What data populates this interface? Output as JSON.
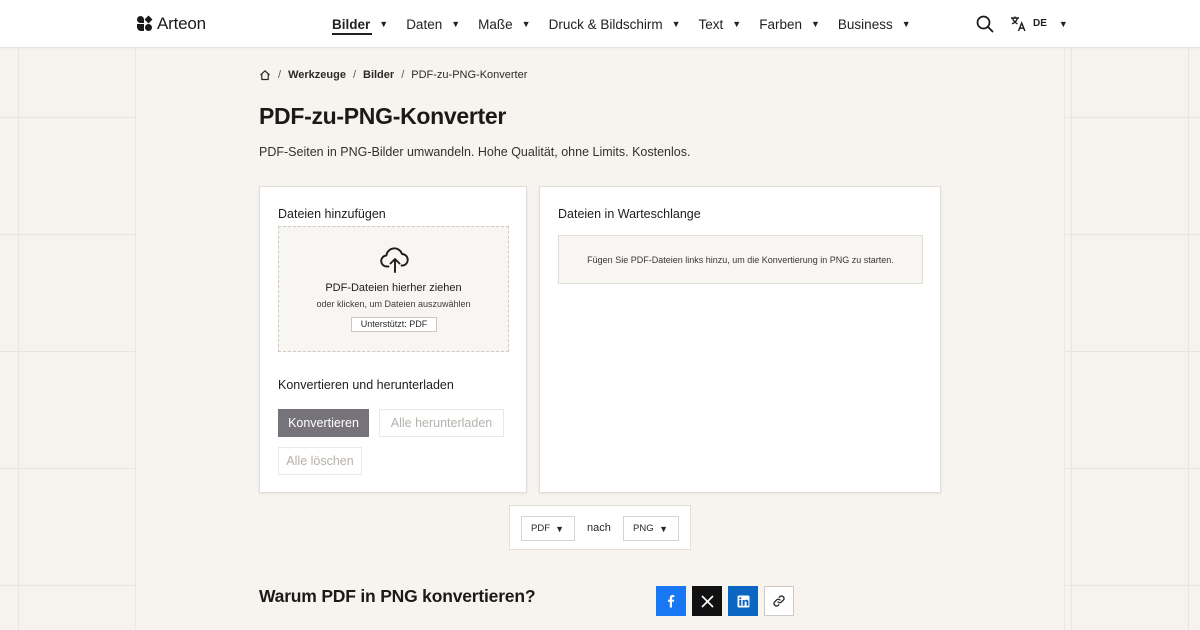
{
  "header": {
    "brand": "Arteon",
    "nav": [
      {
        "label": "Bilder",
        "active": true
      },
      {
        "label": "Daten"
      },
      {
        "label": "Maße"
      },
      {
        "label": "Druck & Bildschirm"
      },
      {
        "label": "Text"
      },
      {
        "label": "Farben"
      },
      {
        "label": "Business"
      }
    ],
    "caret": "▼",
    "search_icon": "search-icon",
    "language": "DE",
    "language_icon": "translate-icon"
  },
  "breadcrumb": {
    "home_icon": "home-icon",
    "separator": "/",
    "items": [
      "Werkzeuge",
      "Bilder",
      "PDF-zu-PNG-Konverter"
    ]
  },
  "page": {
    "title": "PDF-zu-PNG-Konverter",
    "subtitle": "PDF-Seiten in PNG-Bilder umwandeln. Hohe Qualität, ohne Limits. Kostenlos."
  },
  "add_card": {
    "heading": "Dateien hinzufügen",
    "dropzone": {
      "icon": "cloud-upload-icon",
      "title": "PDF-Dateien hierher ziehen",
      "subtitle": "oder klicken, um Dateien auszuwählen",
      "badge": "Unterstützt: PDF"
    },
    "convert_heading": "Konvertieren und herunterladen",
    "convert_button": "Konvertieren",
    "download_all_button": "Alle herunterladen",
    "clear_all_button": "Alle löschen"
  },
  "queue_card": {
    "heading": "Dateien in Warteschlange",
    "empty_message": "Fügen Sie PDF-Dateien links hinzu, um die Konvertierung in PNG zu starten."
  },
  "format_selector": {
    "from": "PDF",
    "connector": "nach",
    "to": "PNG"
  },
  "why_heading": "Warum PDF in PNG konvertieren?",
  "share": [
    {
      "icon": "facebook-icon",
      "color": "#1877f2"
    },
    {
      "icon": "x-icon",
      "color": "#111111"
    },
    {
      "icon": "linkedin-icon",
      "color": "#0a66c2"
    },
    {
      "icon": "link-icon",
      "color": "#ffffff"
    }
  ]
}
